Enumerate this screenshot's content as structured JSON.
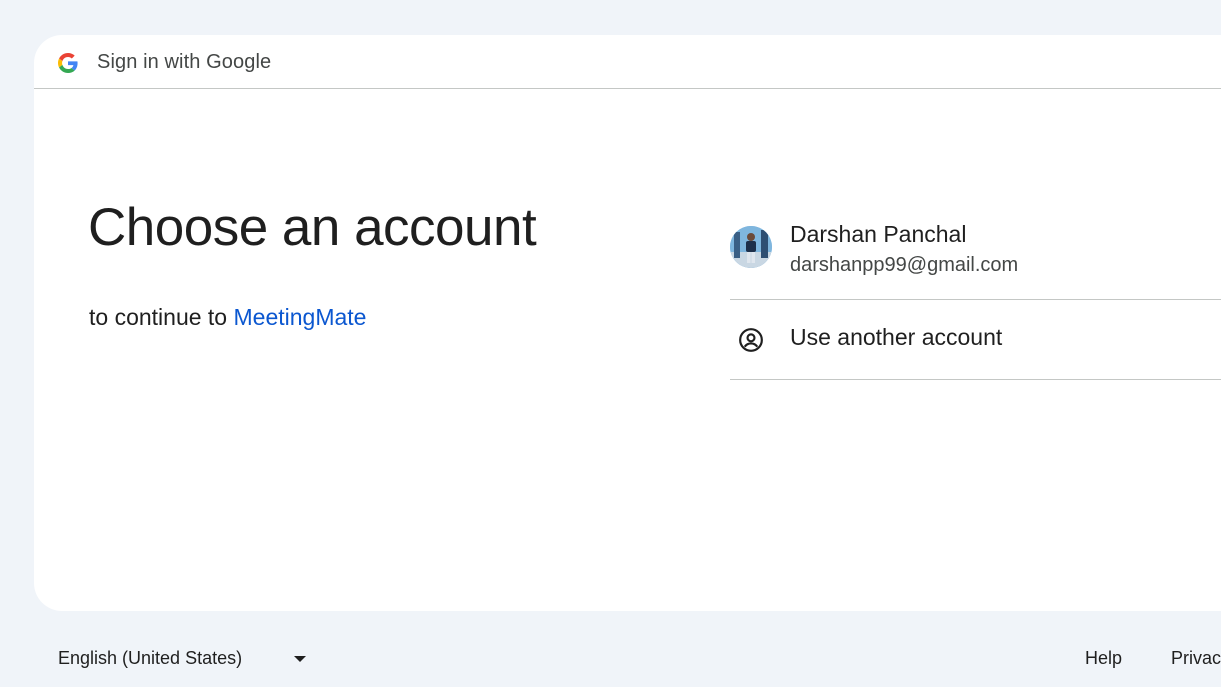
{
  "header": {
    "title": "Sign in with Google"
  },
  "main": {
    "title": "Choose an account",
    "subtitle_prefix": "to continue to",
    "app_name": "MeetingMate"
  },
  "accounts": [
    {
      "name": "Darshan Panchal",
      "email": "darshanpp99@gmail.com"
    }
  ],
  "other_account_label": "Use another account",
  "footer": {
    "language": "English (United States)",
    "help": "Help",
    "privacy": "Privacy"
  },
  "colors": {
    "background": "#f0f4f9",
    "link": "#0b57d0",
    "text": "#1f1f1f",
    "divider": "#c4c7c5"
  }
}
